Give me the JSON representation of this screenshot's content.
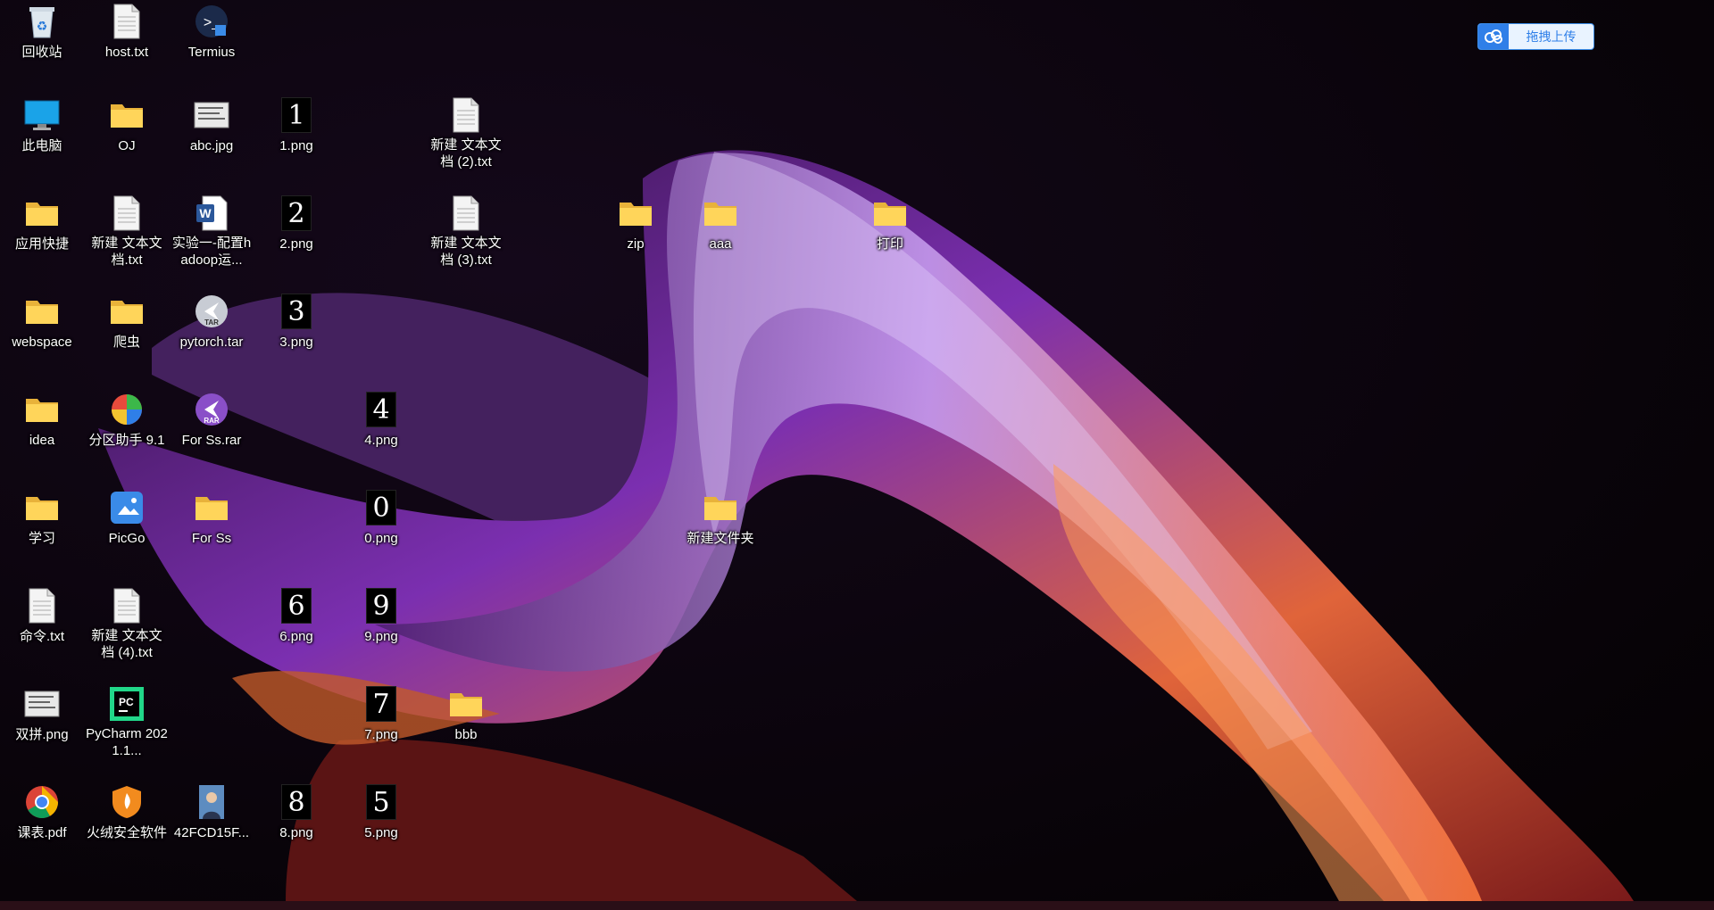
{
  "upload_button": {
    "label": "拖拽上传"
  },
  "desktop_icons": [
    {
      "label": "回收站",
      "type": "recycle",
      "col": 0,
      "row": 0
    },
    {
      "label": "host.txt",
      "type": "txt",
      "col": 1,
      "row": 0
    },
    {
      "label": "Termius",
      "type": "termius",
      "col": 2,
      "row": 0
    },
    {
      "label": "此电脑",
      "type": "pc",
      "col": 0,
      "row": 1
    },
    {
      "label": "OJ",
      "type": "folder",
      "col": 1,
      "row": 1
    },
    {
      "label": "abc.jpg",
      "type": "image",
      "col": 2,
      "row": 1
    },
    {
      "label": "1.png",
      "type": "num",
      "digit": "1",
      "col": 3,
      "row": 1
    },
    {
      "label": "新建 文本文档 (2).txt",
      "type": "txt",
      "col": 5,
      "row": 1
    },
    {
      "label": "应用快捷",
      "type": "folder",
      "col": 0,
      "row": 2
    },
    {
      "label": "新建 文本文档.txt",
      "type": "txt",
      "col": 1,
      "row": 2
    },
    {
      "label": "实验一-配置hadoop运...",
      "type": "word",
      "col": 2,
      "row": 2
    },
    {
      "label": "2.png",
      "type": "num",
      "digit": "2",
      "col": 3,
      "row": 2
    },
    {
      "label": "新建 文本文档 (3).txt",
      "type": "txt",
      "col": 5,
      "row": 2
    },
    {
      "label": "zip",
      "type": "folder",
      "col": 7,
      "row": 2
    },
    {
      "label": "aaa",
      "type": "folder",
      "col": 8,
      "row": 2
    },
    {
      "label": "打印",
      "type": "folder",
      "col": 10,
      "row": 2
    },
    {
      "label": "webspace",
      "type": "folder",
      "col": 0,
      "row": 3
    },
    {
      "label": "爬虫",
      "type": "folder",
      "col": 1,
      "row": 3
    },
    {
      "label": "pytorch.tar",
      "type": "tar",
      "col": 2,
      "row": 3
    },
    {
      "label": "3.png",
      "type": "num",
      "digit": "3",
      "col": 3,
      "row": 3
    },
    {
      "label": "idea",
      "type": "folder",
      "col": 0,
      "row": 4
    },
    {
      "label": "分区助手 9.1",
      "type": "partition",
      "col": 1,
      "row": 4
    },
    {
      "label": "For Ss.rar",
      "type": "rar",
      "col": 2,
      "row": 4
    },
    {
      "label": "4.png",
      "type": "num",
      "digit": "4",
      "col": 4,
      "row": 4
    },
    {
      "label": "学习",
      "type": "folder",
      "col": 0,
      "row": 5
    },
    {
      "label": "PicGo",
      "type": "picgo",
      "col": 1,
      "row": 5
    },
    {
      "label": "For Ss",
      "type": "folder",
      "col": 2,
      "row": 5
    },
    {
      "label": "0.png",
      "type": "num",
      "digit": "0",
      "col": 4,
      "row": 5
    },
    {
      "label": "新建文件夹",
      "type": "folder",
      "col": 8,
      "row": 5
    },
    {
      "label": "命令.txt",
      "type": "txt",
      "col": 0,
      "row": 6
    },
    {
      "label": "新建 文本文档 (4).txt",
      "type": "txt",
      "col": 1,
      "row": 6
    },
    {
      "label": "6.png",
      "type": "num",
      "digit": "6",
      "col": 3,
      "row": 6
    },
    {
      "label": "9.png",
      "type": "num",
      "digit": "9",
      "col": 4,
      "row": 6
    },
    {
      "label": "双拼.png",
      "type": "image",
      "col": 0,
      "row": 7
    },
    {
      "label": "PyCharm 2021.1...",
      "type": "pycharm",
      "col": 1,
      "row": 7
    },
    {
      "label": "7.png",
      "type": "num",
      "digit": "7",
      "col": 4,
      "row": 7
    },
    {
      "label": "bbb",
      "type": "folder",
      "col": 5,
      "row": 7
    },
    {
      "label": "课表.pdf",
      "type": "chrome",
      "col": 0,
      "row": 8
    },
    {
      "label": "火绒安全软件",
      "type": "huorong",
      "col": 1,
      "row": 8
    },
    {
      "label": "42FCD15F...",
      "type": "photo",
      "col": 2,
      "row": 8
    },
    {
      "label": "8.png",
      "type": "num",
      "digit": "8",
      "col": 3,
      "row": 8
    },
    {
      "label": "5.png",
      "type": "num",
      "digit": "5",
      "col": 4,
      "row": 8
    }
  ]
}
